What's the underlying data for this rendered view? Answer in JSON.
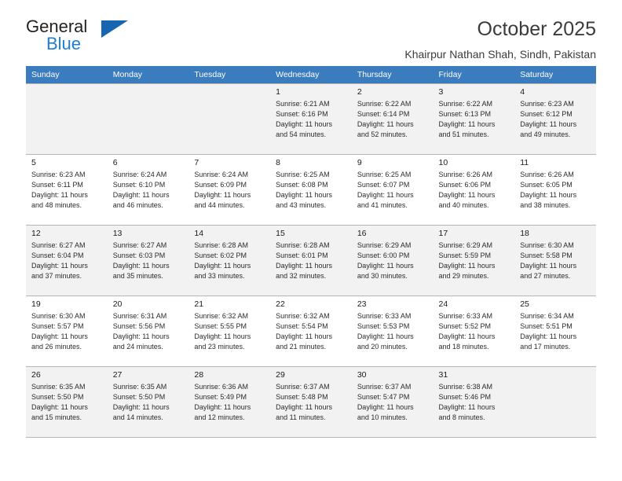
{
  "brand": {
    "name_top": "General",
    "name_bottom": "Blue",
    "triangle_color": "#1667b0",
    "blue_color": "#1a7fd4"
  },
  "header": {
    "title": "October 2025",
    "subtitle": "Khairpur Nathan Shah, Sindh, Pakistan"
  },
  "theme": {
    "header_bg": "#3a7cbe",
    "header_text": "#ffffff",
    "shaded_row_bg": "#f2f2f2",
    "grid_line": "#b5b5b5"
  },
  "weekdays": [
    "Sunday",
    "Monday",
    "Tuesday",
    "Wednesday",
    "Thursday",
    "Friday",
    "Saturday"
  ],
  "labels": {
    "sunrise_prefix": "Sunrise:",
    "sunset_prefix": "Sunset:",
    "daylight_prefix": "Daylight:"
  },
  "weeks": [
    [
      {
        "empty": true
      },
      {
        "empty": true
      },
      {
        "empty": true
      },
      {
        "day": "1",
        "sunrise": "Sunrise: 6:21 AM",
        "sunset": "Sunset: 6:16 PM",
        "daylight1": "Daylight: 11 hours",
        "daylight2": "and 54 minutes."
      },
      {
        "day": "2",
        "sunrise": "Sunrise: 6:22 AM",
        "sunset": "Sunset: 6:14 PM",
        "daylight1": "Daylight: 11 hours",
        "daylight2": "and 52 minutes."
      },
      {
        "day": "3",
        "sunrise": "Sunrise: 6:22 AM",
        "sunset": "Sunset: 6:13 PM",
        "daylight1": "Daylight: 11 hours",
        "daylight2": "and 51 minutes."
      },
      {
        "day": "4",
        "sunrise": "Sunrise: 6:23 AM",
        "sunset": "Sunset: 6:12 PM",
        "daylight1": "Daylight: 11 hours",
        "daylight2": "and 49 minutes."
      }
    ],
    [
      {
        "day": "5",
        "sunrise": "Sunrise: 6:23 AM",
        "sunset": "Sunset: 6:11 PM",
        "daylight1": "Daylight: 11 hours",
        "daylight2": "and 48 minutes."
      },
      {
        "day": "6",
        "sunrise": "Sunrise: 6:24 AM",
        "sunset": "Sunset: 6:10 PM",
        "daylight1": "Daylight: 11 hours",
        "daylight2": "and 46 minutes."
      },
      {
        "day": "7",
        "sunrise": "Sunrise: 6:24 AM",
        "sunset": "Sunset: 6:09 PM",
        "daylight1": "Daylight: 11 hours",
        "daylight2": "and 44 minutes."
      },
      {
        "day": "8",
        "sunrise": "Sunrise: 6:25 AM",
        "sunset": "Sunset: 6:08 PM",
        "daylight1": "Daylight: 11 hours",
        "daylight2": "and 43 minutes."
      },
      {
        "day": "9",
        "sunrise": "Sunrise: 6:25 AM",
        "sunset": "Sunset: 6:07 PM",
        "daylight1": "Daylight: 11 hours",
        "daylight2": "and 41 minutes."
      },
      {
        "day": "10",
        "sunrise": "Sunrise: 6:26 AM",
        "sunset": "Sunset: 6:06 PM",
        "daylight1": "Daylight: 11 hours",
        "daylight2": "and 40 minutes."
      },
      {
        "day": "11",
        "sunrise": "Sunrise: 6:26 AM",
        "sunset": "Sunset: 6:05 PM",
        "daylight1": "Daylight: 11 hours",
        "daylight2": "and 38 minutes."
      }
    ],
    [
      {
        "day": "12",
        "sunrise": "Sunrise: 6:27 AM",
        "sunset": "Sunset: 6:04 PM",
        "daylight1": "Daylight: 11 hours",
        "daylight2": "and 37 minutes."
      },
      {
        "day": "13",
        "sunrise": "Sunrise: 6:27 AM",
        "sunset": "Sunset: 6:03 PM",
        "daylight1": "Daylight: 11 hours",
        "daylight2": "and 35 minutes."
      },
      {
        "day": "14",
        "sunrise": "Sunrise: 6:28 AM",
        "sunset": "Sunset: 6:02 PM",
        "daylight1": "Daylight: 11 hours",
        "daylight2": "and 33 minutes."
      },
      {
        "day": "15",
        "sunrise": "Sunrise: 6:28 AM",
        "sunset": "Sunset: 6:01 PM",
        "daylight1": "Daylight: 11 hours",
        "daylight2": "and 32 minutes."
      },
      {
        "day": "16",
        "sunrise": "Sunrise: 6:29 AM",
        "sunset": "Sunset: 6:00 PM",
        "daylight1": "Daylight: 11 hours",
        "daylight2": "and 30 minutes."
      },
      {
        "day": "17",
        "sunrise": "Sunrise: 6:29 AM",
        "sunset": "Sunset: 5:59 PM",
        "daylight1": "Daylight: 11 hours",
        "daylight2": "and 29 minutes."
      },
      {
        "day": "18",
        "sunrise": "Sunrise: 6:30 AM",
        "sunset": "Sunset: 5:58 PM",
        "daylight1": "Daylight: 11 hours",
        "daylight2": "and 27 minutes."
      }
    ],
    [
      {
        "day": "19",
        "sunrise": "Sunrise: 6:30 AM",
        "sunset": "Sunset: 5:57 PM",
        "daylight1": "Daylight: 11 hours",
        "daylight2": "and 26 minutes."
      },
      {
        "day": "20",
        "sunrise": "Sunrise: 6:31 AM",
        "sunset": "Sunset: 5:56 PM",
        "daylight1": "Daylight: 11 hours",
        "daylight2": "and 24 minutes."
      },
      {
        "day": "21",
        "sunrise": "Sunrise: 6:32 AM",
        "sunset": "Sunset: 5:55 PM",
        "daylight1": "Daylight: 11 hours",
        "daylight2": "and 23 minutes."
      },
      {
        "day": "22",
        "sunrise": "Sunrise: 6:32 AM",
        "sunset": "Sunset: 5:54 PM",
        "daylight1": "Daylight: 11 hours",
        "daylight2": "and 21 minutes."
      },
      {
        "day": "23",
        "sunrise": "Sunrise: 6:33 AM",
        "sunset": "Sunset: 5:53 PM",
        "daylight1": "Daylight: 11 hours",
        "daylight2": "and 20 minutes."
      },
      {
        "day": "24",
        "sunrise": "Sunrise: 6:33 AM",
        "sunset": "Sunset: 5:52 PM",
        "daylight1": "Daylight: 11 hours",
        "daylight2": "and 18 minutes."
      },
      {
        "day": "25",
        "sunrise": "Sunrise: 6:34 AM",
        "sunset": "Sunset: 5:51 PM",
        "daylight1": "Daylight: 11 hours",
        "daylight2": "and 17 minutes."
      }
    ],
    [
      {
        "day": "26",
        "sunrise": "Sunrise: 6:35 AM",
        "sunset": "Sunset: 5:50 PM",
        "daylight1": "Daylight: 11 hours",
        "daylight2": "and 15 minutes."
      },
      {
        "day": "27",
        "sunrise": "Sunrise: 6:35 AM",
        "sunset": "Sunset: 5:50 PM",
        "daylight1": "Daylight: 11 hours",
        "daylight2": "and 14 minutes."
      },
      {
        "day": "28",
        "sunrise": "Sunrise: 6:36 AM",
        "sunset": "Sunset: 5:49 PM",
        "daylight1": "Daylight: 11 hours",
        "daylight2": "and 12 minutes."
      },
      {
        "day": "29",
        "sunrise": "Sunrise: 6:37 AM",
        "sunset": "Sunset: 5:48 PM",
        "daylight1": "Daylight: 11 hours",
        "daylight2": "and 11 minutes."
      },
      {
        "day": "30",
        "sunrise": "Sunrise: 6:37 AM",
        "sunset": "Sunset: 5:47 PM",
        "daylight1": "Daylight: 11 hours",
        "daylight2": "and 10 minutes."
      },
      {
        "day": "31",
        "sunrise": "Sunrise: 6:38 AM",
        "sunset": "Sunset: 5:46 PM",
        "daylight1": "Daylight: 11 hours",
        "daylight2": "and 8 minutes."
      },
      {
        "empty": true
      }
    ]
  ]
}
